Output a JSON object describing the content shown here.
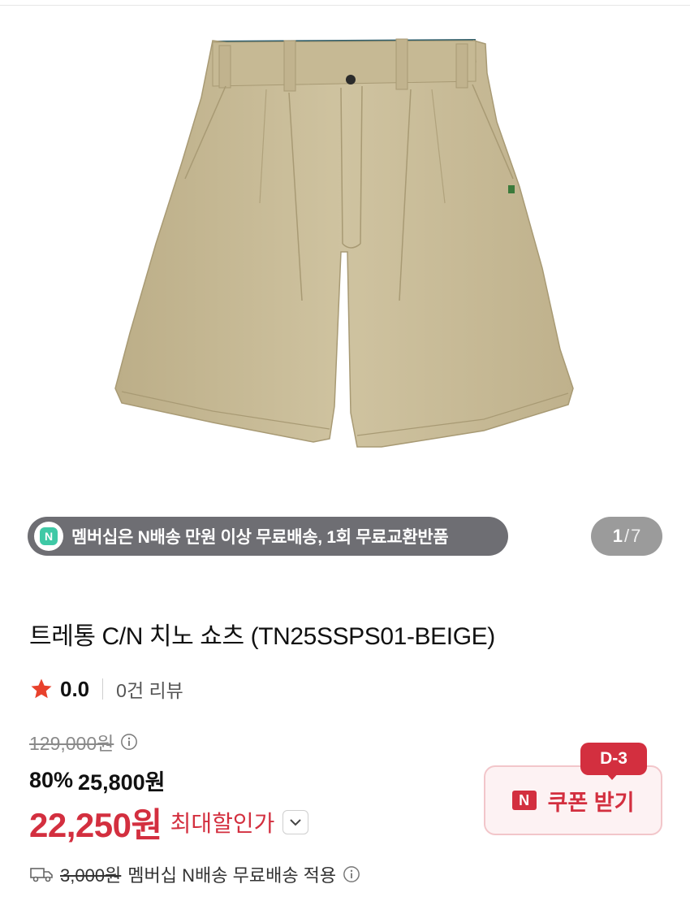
{
  "banner": {
    "text": "멤버십은 N배송 만원 이상 무료배송, 1회 무료교환반품"
  },
  "pagination": {
    "current": "1",
    "separator": "/",
    "total": "7"
  },
  "product": {
    "title": "트레통 C/N 치노 쇼츠 (TN25SSPS01-BEIGE)",
    "rating": "0.0",
    "review_count": "0건 리뷰"
  },
  "price": {
    "original": "129,000원",
    "discount_rate": "80%",
    "sale": "25,800원",
    "max_discount_price": "22,250원",
    "max_discount_label": "최대할인가"
  },
  "coupon": {
    "button_label": "쿠폰 받기",
    "dday": "D-3",
    "n_mark": "N"
  },
  "shipping": {
    "fee": "3,000원",
    "text": "멤버십 N배송 무료배송 적용"
  },
  "colors": {
    "accent": "#d32f3f",
    "banner_bg": "#6e6e73",
    "counter_bg": "#9b9b9b",
    "product_beige": "#c9bc98",
    "lining": "#2f5e6b"
  }
}
